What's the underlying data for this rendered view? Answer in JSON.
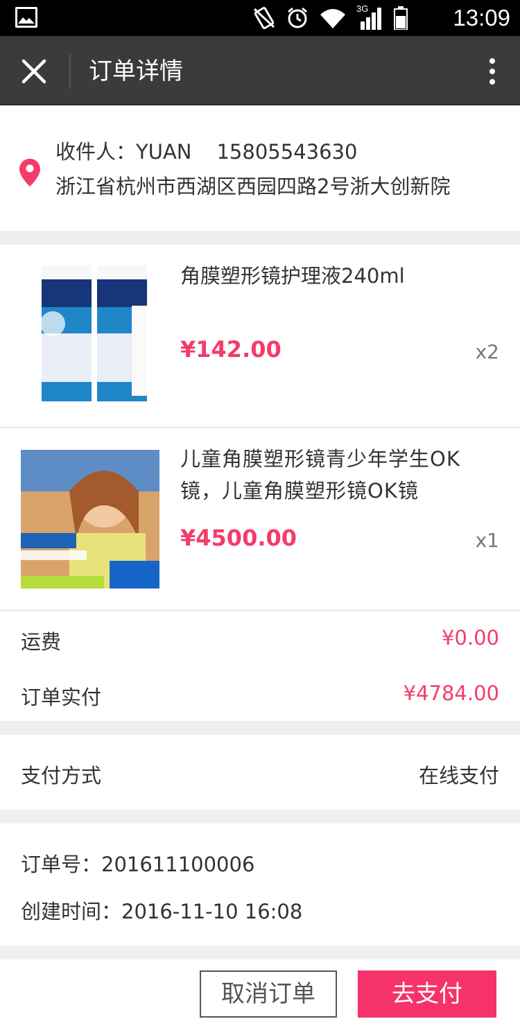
{
  "statusbar": {
    "time": "13:09",
    "network": "3G"
  },
  "appbar": {
    "title": "订单详情"
  },
  "address": {
    "recipient": "收件人：YUAN",
    "phone": "15805543630",
    "detail": "浙江省杭州市西湖区西园四路2号浙大创新院"
  },
  "products": [
    {
      "name": "角膜塑形镜护理液240ml",
      "price": "¥142.00",
      "qty": "x2"
    },
    {
      "name": "儿童角膜塑形镜青少年学生OK镜，儿童角膜塑形镜OK镜",
      "price": "¥4500.00",
      "qty": "x1"
    }
  ],
  "summary": {
    "shipping_label": "运费",
    "shipping_value": "¥0.00",
    "paid_label": "订单实付",
    "paid_value": "¥4784.00"
  },
  "payment": {
    "label": "支付方式",
    "value": "在线支付"
  },
  "order": {
    "number": "订单号：201611100006",
    "created": "创建时间：2016-11-10  16:08"
  },
  "footer": {
    "cancel_label": "取消订单",
    "pay_label": "去支付"
  },
  "colors": {
    "accent": "#f43b6a",
    "appbar": "#3a3b3d",
    "background": "#efefef"
  }
}
